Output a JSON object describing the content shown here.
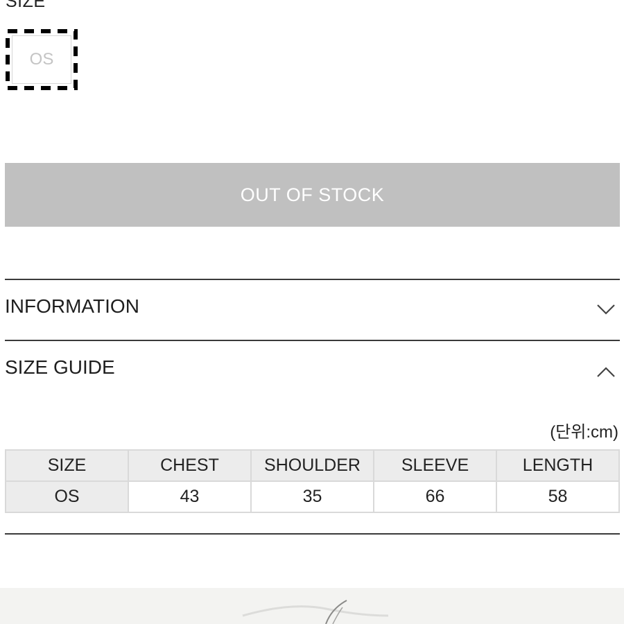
{
  "size_selector": {
    "heading": "SIZE",
    "options": [
      "OS"
    ]
  },
  "stock_button": {
    "label": "OUT OF STOCK"
  },
  "accordions": {
    "information": {
      "label": "INFORMATION",
      "icon": "chevron-down-icon"
    },
    "size_guide": {
      "label": "SIZE GUIDE",
      "icon": "chevron-up-icon"
    }
  },
  "size_guide": {
    "unit_note": "(단위:cm)",
    "table": {
      "headers": [
        "SIZE",
        "CHEST",
        "SHOULDER",
        "SLEEVE",
        "LENGTH"
      ],
      "rows": [
        [
          "OS",
          "43",
          "35",
          "66",
          "58"
        ]
      ]
    }
  },
  "colors": {
    "button_disabled_bg": "#c0c0c0",
    "divider": "#3a3a3a",
    "table_header_bg": "#ececec"
  }
}
